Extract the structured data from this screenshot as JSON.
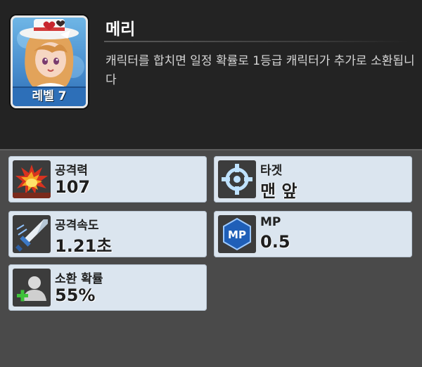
{
  "character": {
    "name": "메리",
    "level_label": "레벨 7",
    "description": "캐릭터를 합치면 일정 확률로 1등급 캐릭터가 추가로 소환됩니다"
  },
  "stats": {
    "attack": {
      "label": "공격력",
      "value": "107",
      "icon": "explosion-icon"
    },
    "target": {
      "label": "타겟",
      "value": "맨 앞",
      "icon": "crosshair-icon"
    },
    "attack_speed": {
      "label": "공격속도",
      "value": "1.21초",
      "icon": "sword-icon"
    },
    "mp": {
      "label": "MP",
      "value": "0.5",
      "icon": "mp-icon",
      "icon_text": "MP"
    },
    "summon_rate": {
      "label": "소환 확률",
      "value": "55%",
      "icon": "add-user-icon"
    }
  },
  "colors": {
    "background": "#232323",
    "panel": "#4a4a4a",
    "card": "#dbe5ef",
    "level_badge": "#2d6fb8"
  }
}
